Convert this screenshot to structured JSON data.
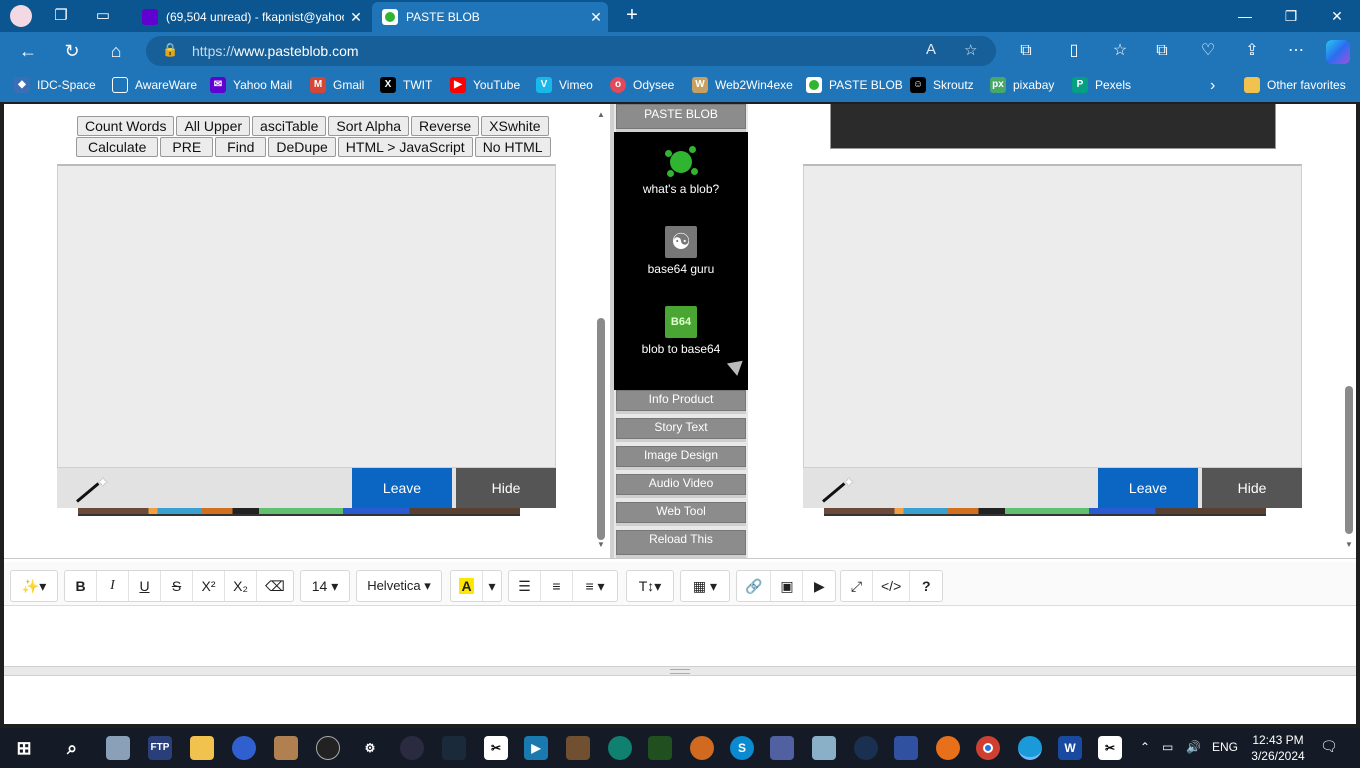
{
  "browser": {
    "tabs": [
      {
        "title": "(69,504 unread) - fkapnist@yahoo",
        "active": false
      },
      {
        "title": "PASTE BLOB",
        "active": true
      }
    ],
    "url_protocol": "https://",
    "url_host": "www.pasteblob.com",
    "favorites": [
      {
        "label": "IDC-Space"
      },
      {
        "label": "AwareWare"
      },
      {
        "label": "Yahoo Mail"
      },
      {
        "label": "Gmail"
      },
      {
        "label": "TWIT"
      },
      {
        "label": "YouTube"
      },
      {
        "label": "Vimeo"
      },
      {
        "label": "Odysee"
      },
      {
        "label": "Web2Win4exe"
      },
      {
        "label": "PASTE BLOB"
      },
      {
        "label": "Skroutz"
      },
      {
        "label": "pixabay"
      },
      {
        "label": "Pexels"
      }
    ],
    "other_favorites": "Other favorites"
  },
  "left_panel": {
    "row1": [
      "Count Words",
      "All Upper",
      "asciTable",
      "Sort Alpha",
      "Reverse",
      "XSwhite"
    ],
    "row2": [
      "Calculate",
      "PRE",
      "Find",
      "DeDupe",
      "HTML > JavaScript",
      "No HTML"
    ],
    "leave": "Leave",
    "hide": "Hide"
  },
  "middle_panel": {
    "top_button": "PASTE BLOB",
    "items": [
      {
        "label": "what's a blob?",
        "icon": "blob-splat-icon"
      },
      {
        "label": "base64 guru",
        "icon": "guru-icon"
      },
      {
        "label": "blob to base64",
        "icon": "b64-icon",
        "icon_text": "B64"
      }
    ],
    "buttons": [
      "Info Product",
      "Story Text",
      "Image Design",
      "Audio Video",
      "Web Tool",
      "Reload This"
    ]
  },
  "right_panel": {
    "leave": "Leave",
    "hide": "Hide"
  },
  "rich_editor": {
    "font_size": "14",
    "font_family": "Helvetica",
    "help": "?"
  },
  "taskbar": {
    "language": "ENG",
    "time": "12:43 PM",
    "date": "3/26/2024"
  },
  "colors": {
    "browser_chrome": "#1f75b8",
    "leave_button": "#0a66c2",
    "hide_button": "#555555",
    "side_button": "#8c8c8c"
  }
}
